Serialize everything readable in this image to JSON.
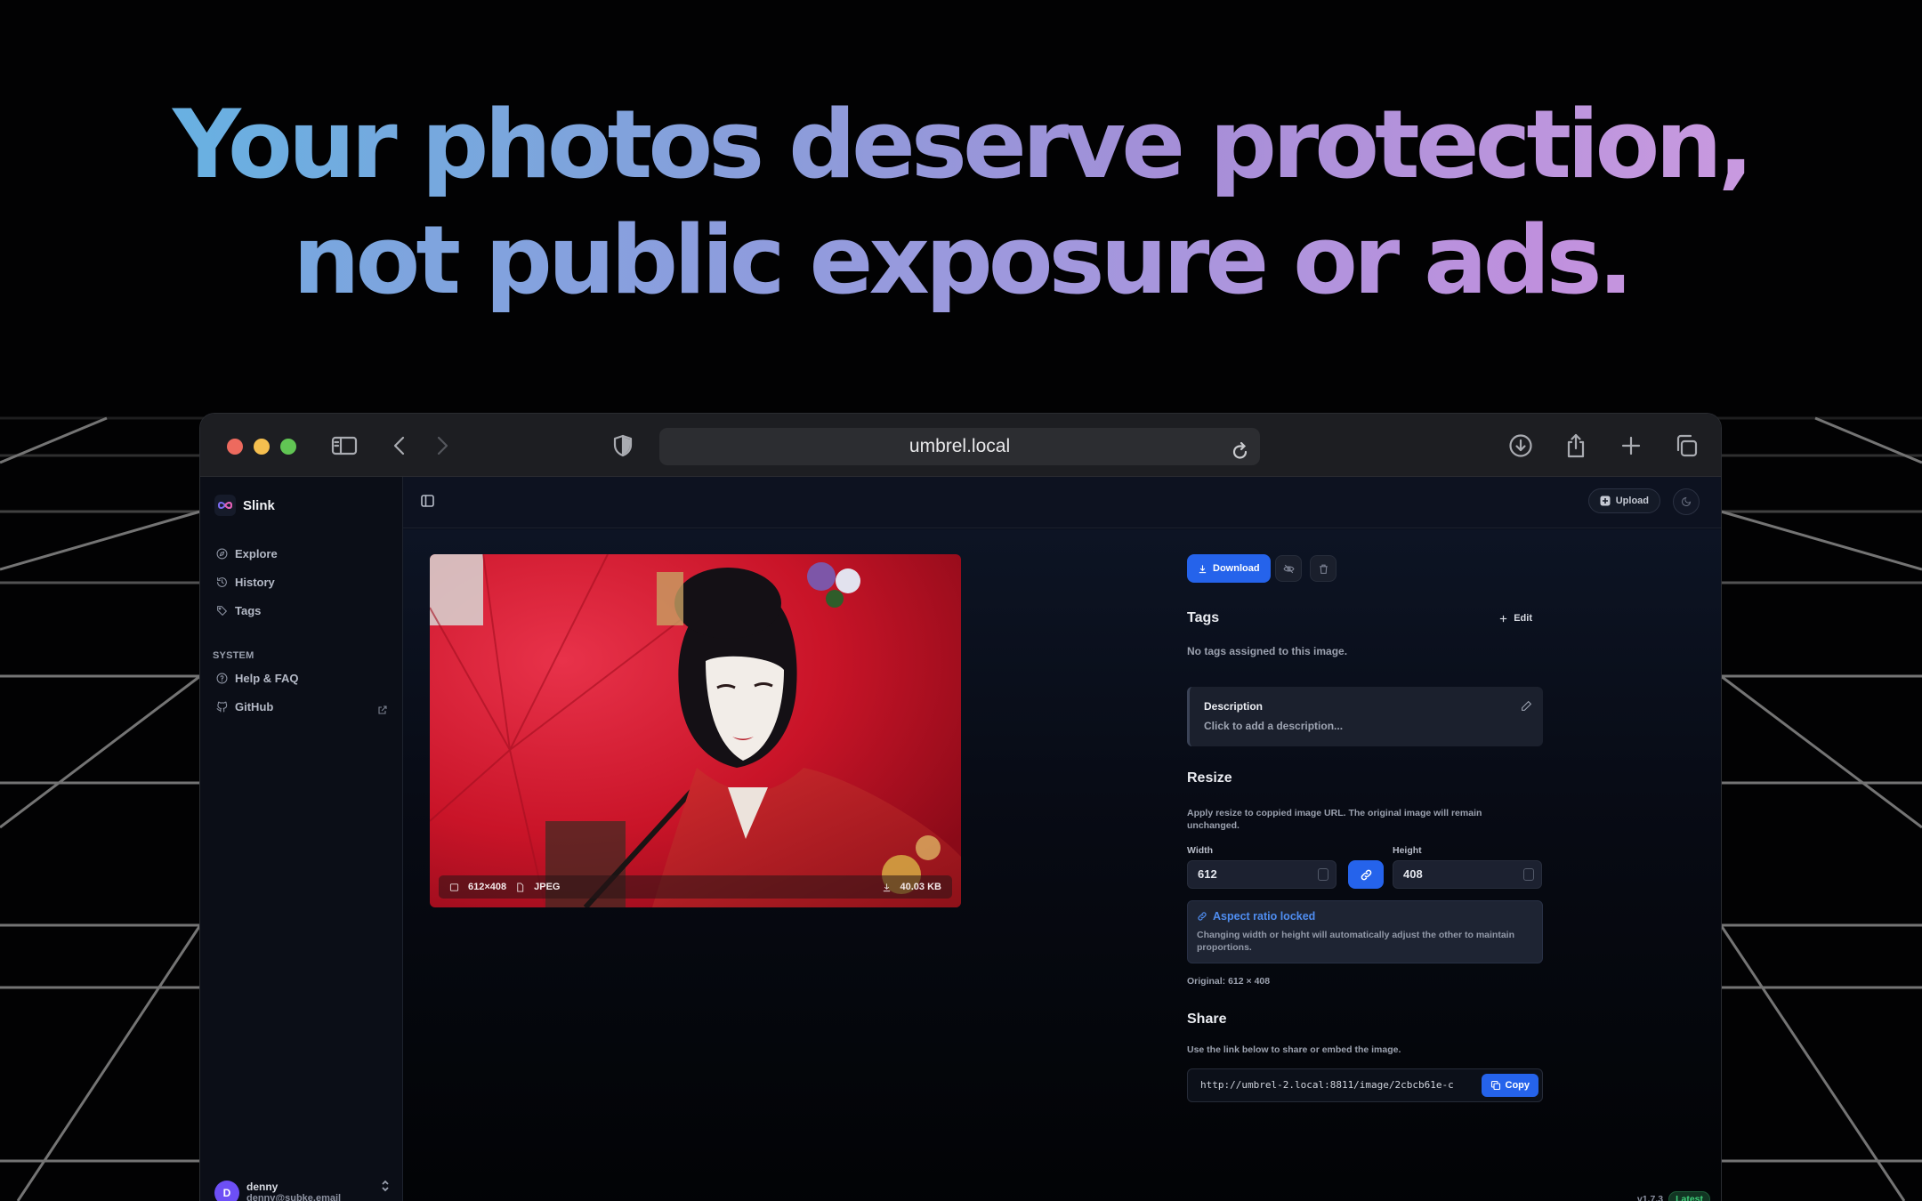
{
  "hero": {
    "line1": "Your photos deserve protection,",
    "line2": "not public exposure or ads."
  },
  "browser": {
    "url": "umbrel.local",
    "icons": [
      "sidebar-icon",
      "back-icon",
      "forward-icon",
      "shield-icon",
      "reload-icon",
      "download-icon",
      "share-icon",
      "new-tab-icon",
      "tabs-icon"
    ]
  },
  "app": {
    "name": "Slink",
    "nav": [
      {
        "label": "Explore",
        "icon": "compass-icon"
      },
      {
        "label": "History",
        "icon": "history-icon"
      },
      {
        "label": "Tags",
        "icon": "tag-icon"
      }
    ],
    "system_label": "SYSTEM",
    "system_nav": [
      {
        "label": "Help & FAQ",
        "icon": "help-icon"
      },
      {
        "label": "GitHub",
        "icon": "github-icon"
      }
    ],
    "user": {
      "initial": "D",
      "name": "denny",
      "email": "denny@subke.email"
    },
    "upload_label": "Upload",
    "version": "v1.7.3",
    "version_badge": "Latest"
  },
  "image": {
    "dimensions": "612×408",
    "format": "JPEG",
    "size": "40.03 KB"
  },
  "details": {
    "download_label": "Download",
    "tags_title": "Tags",
    "edit_label": "Edit",
    "no_tags": "No tags assigned to this image.",
    "description_title": "Description",
    "description_placeholder": "Click to add a description...",
    "resize_title": "Resize",
    "resize_note": "Apply resize to coppied image URL. The original image will remain unchanged.",
    "width_label": "Width",
    "width_value": "612",
    "height_label": "Height",
    "height_value": "408",
    "aspect_title": "Aspect ratio locked",
    "aspect_text": "Changing width or height will automatically adjust the other to maintain proportions.",
    "original": "Original: 612 × 408",
    "share_title": "Share",
    "share_note": "Use the link below to share or embed the image.",
    "share_url": "http://umbrel-2.local:8811/image/2cbcb61e-c",
    "copy_label": "Copy"
  },
  "colors": {
    "accent": "#2563eb",
    "hero_gradient_start": "#5fb6e4",
    "hero_gradient_end": "#d49de2",
    "latest_green": "#3fcf7a"
  }
}
